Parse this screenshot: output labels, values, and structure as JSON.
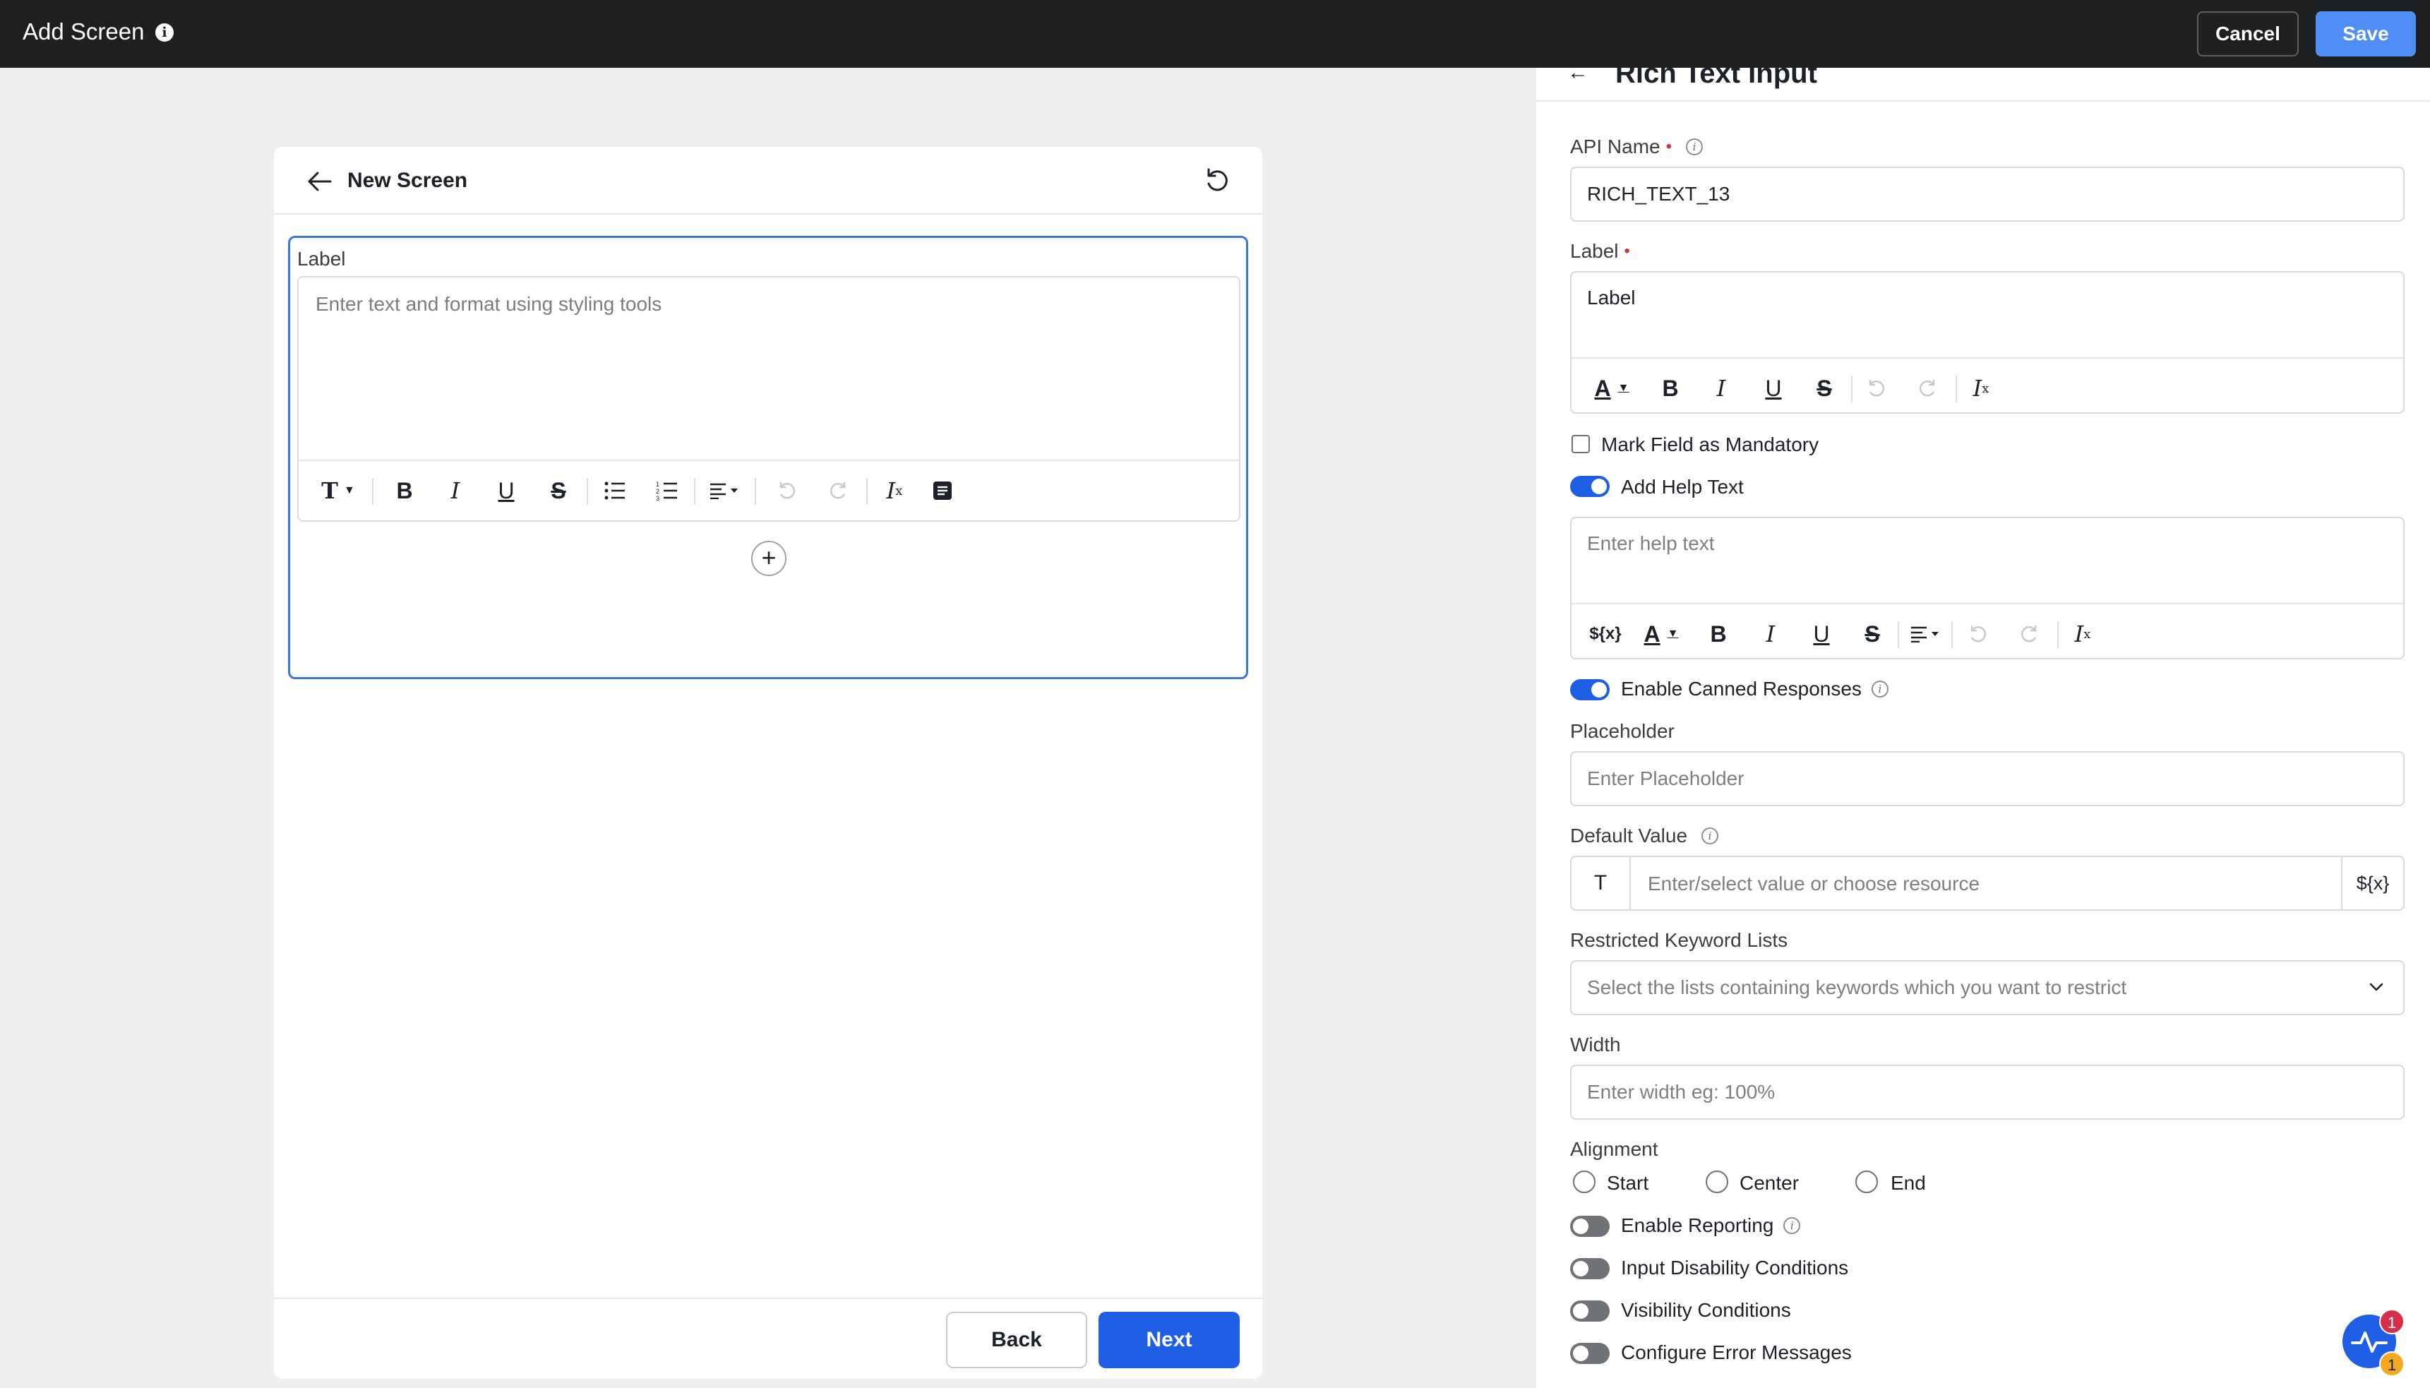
{
  "topbar": {
    "title": "Add Screen",
    "info_icon": "info-circle-icon",
    "cancel_label": "Cancel",
    "save_label": "Save"
  },
  "screen": {
    "title": "New Screen",
    "field": {
      "label": "Label",
      "placeholder": "Enter text and format using styling tools"
    },
    "toolbar_icons": [
      "text-style-icon",
      "bold-icon",
      "italic-icon",
      "underline-icon",
      "strikethrough-icon",
      "bullet-list-icon",
      "numbered-list-icon",
      "align-icon",
      "undo-icon",
      "redo-icon",
      "clear-format-icon",
      "canned-response-icon"
    ],
    "back_label": "Back",
    "next_label": "Next"
  },
  "panel": {
    "title": "Rich Text Input",
    "api_name_label": "API Name",
    "api_name_value": "RICH_TEXT_13",
    "label_label": "Label",
    "label_value": "Label",
    "mandatory_label": "Mark Field as Mandatory",
    "mandatory_checked": false,
    "help_text_label": "Add Help Text",
    "help_text_on": true,
    "help_text_placeholder": "Enter help text",
    "variable_glyph": "${x}",
    "canned_label": "Enable Canned Responses",
    "canned_on": true,
    "placeholder_label": "Placeholder",
    "placeholder_placeholder": "Enter Placeholder",
    "default_label": "Default Value",
    "default_prefix": "T",
    "default_placeholder": "Enter/select value or choose resource",
    "default_suffix": "${x}",
    "restricted_label": "Restricted Keyword Lists",
    "restricted_placeholder": "Select the lists containing keywords which you want to restrict",
    "width_label": "Width",
    "width_placeholder": "Enter width eg: 100%",
    "alignment_label": "Alignment",
    "alignment_options": [
      "Start",
      "Center",
      "End"
    ],
    "reporting_label": "Enable Reporting",
    "disability_label": "Input Disability Conditions",
    "visibility_label": "Visibility Conditions",
    "errors_label": "Configure Error Messages"
  },
  "fab": {
    "badge_top": "1",
    "badge_bottom": "1"
  },
  "colors": {
    "topbar_bg": "#1e1f21",
    "accent": "#1f5fe6",
    "save_bg": "#4f8ef7",
    "required": "#d0343a"
  }
}
